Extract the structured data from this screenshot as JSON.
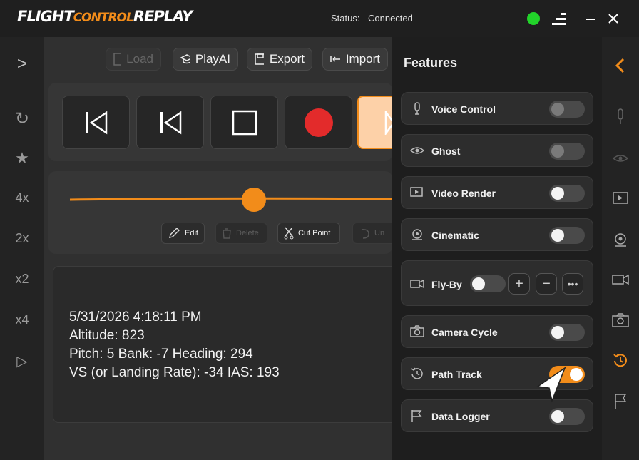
{
  "app": {
    "logo_parts": [
      "FLIGHT",
      "CONTROL",
      "REPLAY"
    ],
    "status_label": "Status:",
    "status_value": "Connected",
    "status_color": "#22d32a"
  },
  "leftnav": {
    "items": [
      {
        "icon": "chevron-right-icon",
        "label": ">"
      },
      {
        "icon": "refresh-icon",
        "label": "↻"
      },
      {
        "icon": "star-icon",
        "label": "★"
      },
      {
        "label": "4x"
      },
      {
        "label": "2x"
      },
      {
        "label": "x2"
      },
      {
        "label": "x4"
      },
      {
        "icon": "play-outline-icon",
        "label": "▷"
      }
    ]
  },
  "toolbar": {
    "load_label": "Load",
    "playai_label": "PlayAI",
    "export_label": "Export",
    "import_label": "Import"
  },
  "edit_bar": {
    "edit_label": "Edit",
    "delete_label": "Delete",
    "cut_point_label": "Cut Point",
    "undo_label": "Un"
  },
  "timeline": {
    "position_fraction": 0.57
  },
  "info": {
    "datetime": "5/31/2026 4:18:11 PM",
    "altitude": "Altitude: 823",
    "attitude": "Pitch: 5 Bank: -7 Heading: 294",
    "speed": "VS (or Landing Rate): -34 IAS: 193"
  },
  "features": {
    "title": "Features",
    "items": [
      {
        "label": "Voice Control",
        "icon": "microphone-icon",
        "state": "off"
      },
      {
        "label": "Ghost",
        "icon": "eye-icon",
        "state": "off"
      },
      {
        "label": "Video Render",
        "icon": "video-render-icon",
        "state": "off"
      },
      {
        "label": "Cinematic",
        "icon": "cinematic-camera-icon",
        "state": "off"
      },
      {
        "label": "Fly-By",
        "icon": "video-camera-icon",
        "state": "off"
      },
      {
        "label": "Camera Cycle",
        "icon": "camera-icon",
        "state": "off"
      },
      {
        "label": "Path Track",
        "icon": "history-icon",
        "state": "on"
      },
      {
        "label": "Data Logger",
        "icon": "flag-icon",
        "state": "off"
      }
    ]
  },
  "colors": {
    "accent": "#f28c1a",
    "record": "#e32b2b"
  }
}
